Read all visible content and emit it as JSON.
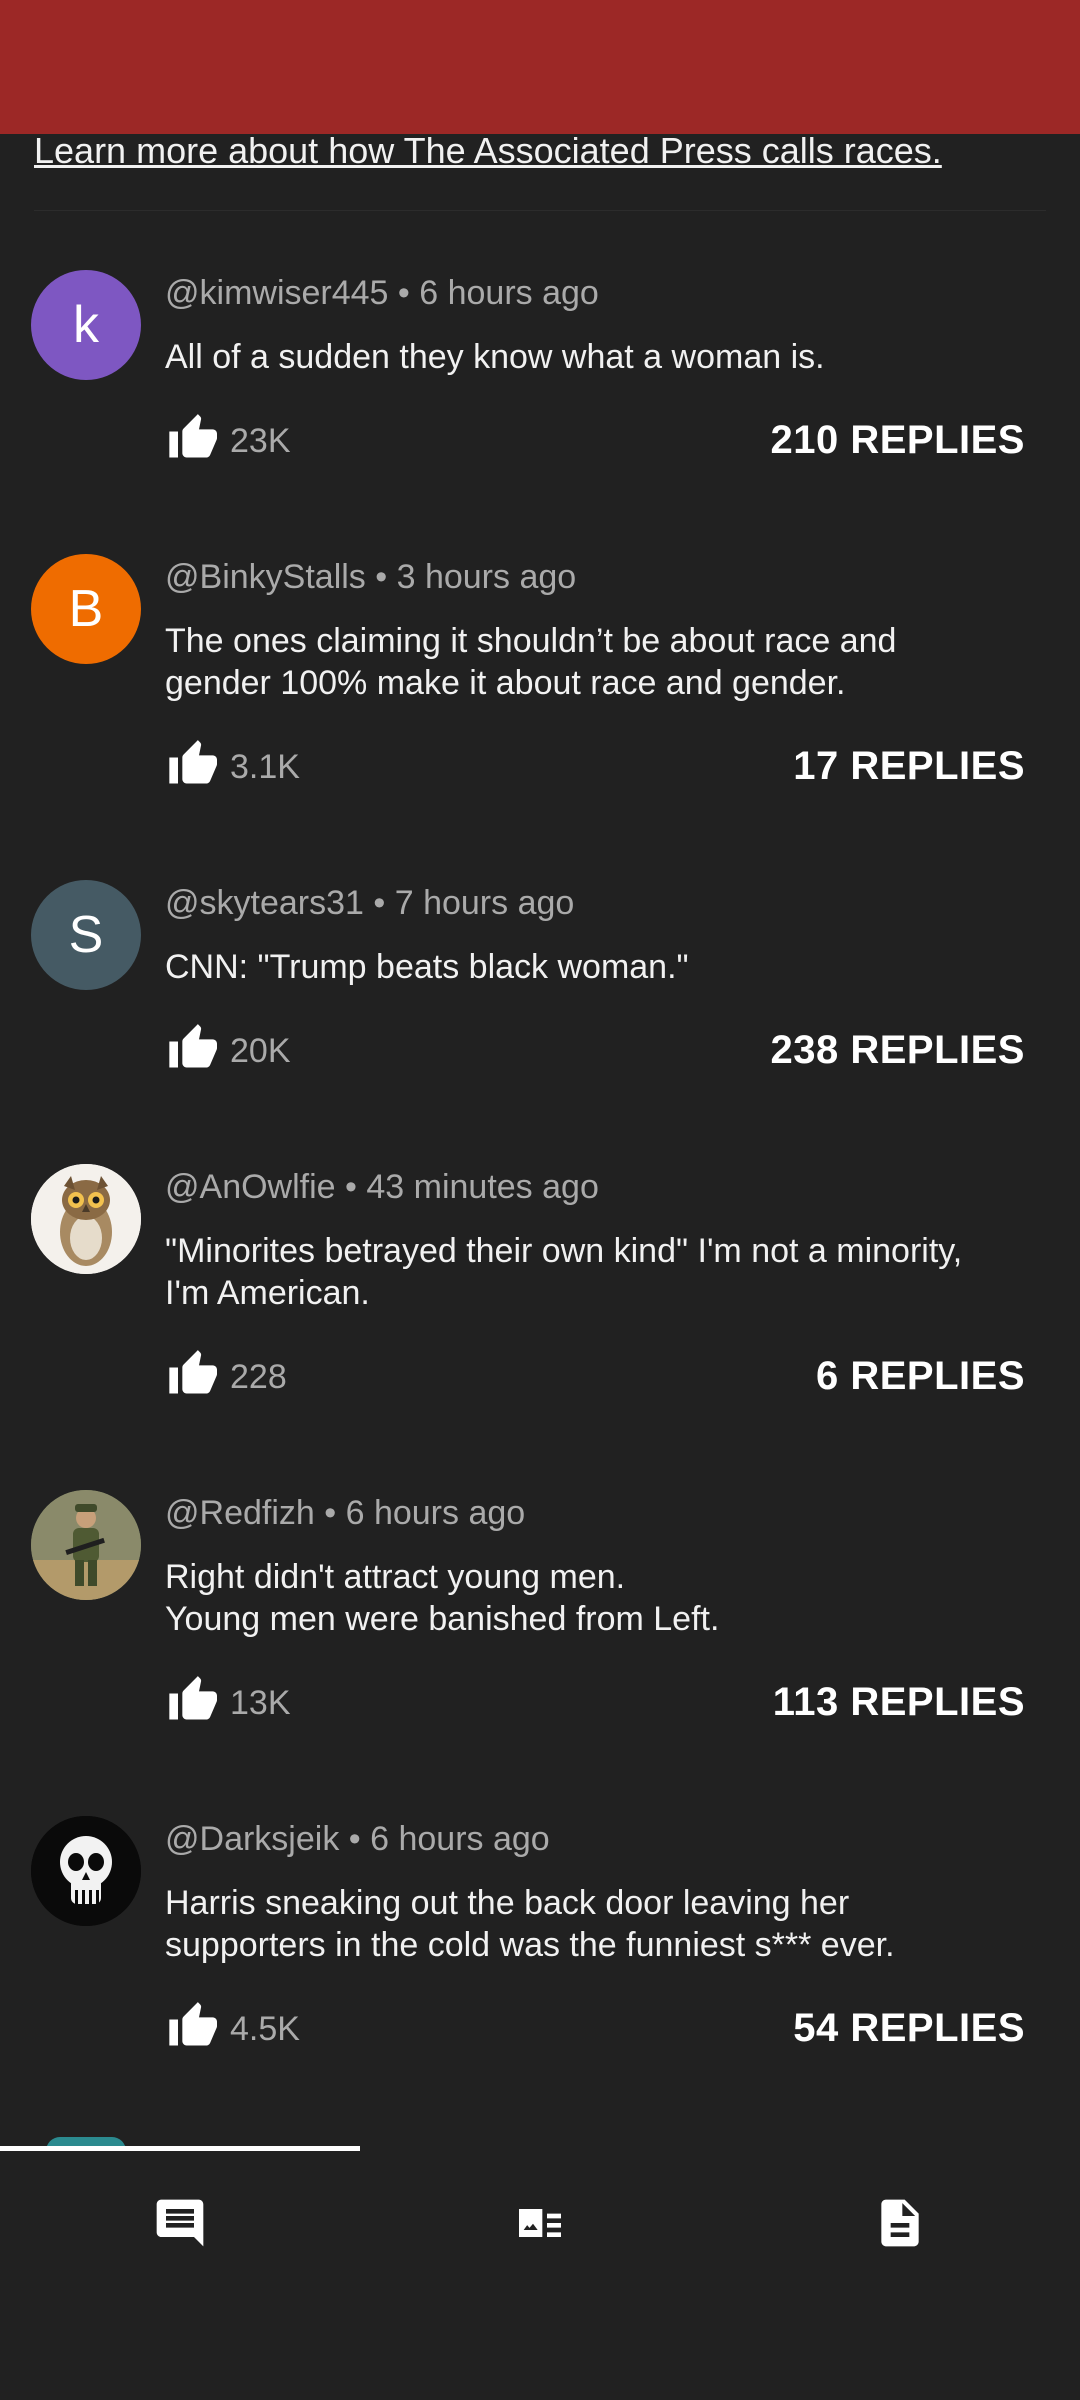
{
  "header": {
    "learn_more": "Learn more about how The Associated Press calls races.",
    "bar_color": "#9c2826"
  },
  "comments": [
    {
      "avatar_letter": "k",
      "avatar_color": "#7e57c2",
      "meta": "@kimwiser445 • 6 hours ago",
      "lines": [
        "All of a sudden they know what a woman is."
      ],
      "likes": "23K",
      "replies": "210 REPLIES"
    },
    {
      "avatar_letter": "B",
      "avatar_color": "#ef6c00",
      "meta": "@BinkyStalls • 3 hours ago",
      "lines": [
        "The ones claiming it shouldn’t be about race and",
        "gender 100% make it about race and gender."
      ],
      "likes": "3.1K",
      "replies": "17 REPLIES"
    },
    {
      "avatar_letter": "S",
      "avatar_color": "#455a64",
      "meta": "@skytears31 • 7 hours ago",
      "lines": [
        "CNN: \"Trump beats black woman.\""
      ],
      "likes": "20K",
      "replies": "238 REPLIES"
    },
    {
      "avatar_icon": "owl-avatar",
      "meta": "@AnOwlfie • 43 minutes ago",
      "lines": [
        "\"Minorites betrayed their own kind\" I'm not a minority,",
        "I'm American."
      ],
      "likes": "228",
      "replies": "6 REPLIES"
    },
    {
      "avatar_icon": "soldier-avatar",
      "meta": "@Redfizh • 6 hours ago",
      "lines": [
        "Right didn't attract young men.",
        "Young men were banished from Left."
      ],
      "likes": "13K",
      "replies": "113 REPLIES"
    },
    {
      "avatar_icon": "skull-avatar",
      "meta": "@Darksjeik • 6 hours ago",
      "lines": [
        "Harris sneaking out the back door leaving her",
        "supporters in the cold was the funniest s*** ever."
      ],
      "likes": "4.5K",
      "replies": "54 REPLIES"
    }
  ],
  "tabs": [
    {
      "icon": "comments-icon",
      "active": true
    },
    {
      "icon": "details-icon",
      "active": false
    },
    {
      "icon": "document-icon",
      "active": false
    }
  ]
}
